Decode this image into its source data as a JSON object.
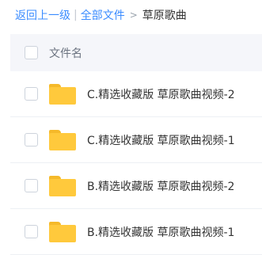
{
  "breadcrumb": {
    "back": "返回上一级",
    "separator": "|",
    "all_files": "全部文件",
    "arrow": ">",
    "current": "草原歌曲"
  },
  "header": {
    "column_name": "文件名"
  },
  "files": [
    {
      "name": "C.精选收藏版 草原歌曲视频-2",
      "icon": "folder-icon"
    },
    {
      "name": "C.精选收藏版 草原歌曲视频-1",
      "icon": "folder-icon"
    },
    {
      "name": "B.精选收藏版 草原歌曲视频-2",
      "icon": "folder-icon"
    },
    {
      "name": "B.精选收藏版 草原歌曲视频-1",
      "icon": "folder-icon"
    }
  ],
  "colors": {
    "link": "#3b8cff",
    "folder": "#ffc93c",
    "header_bg": "#f5f6fa"
  }
}
